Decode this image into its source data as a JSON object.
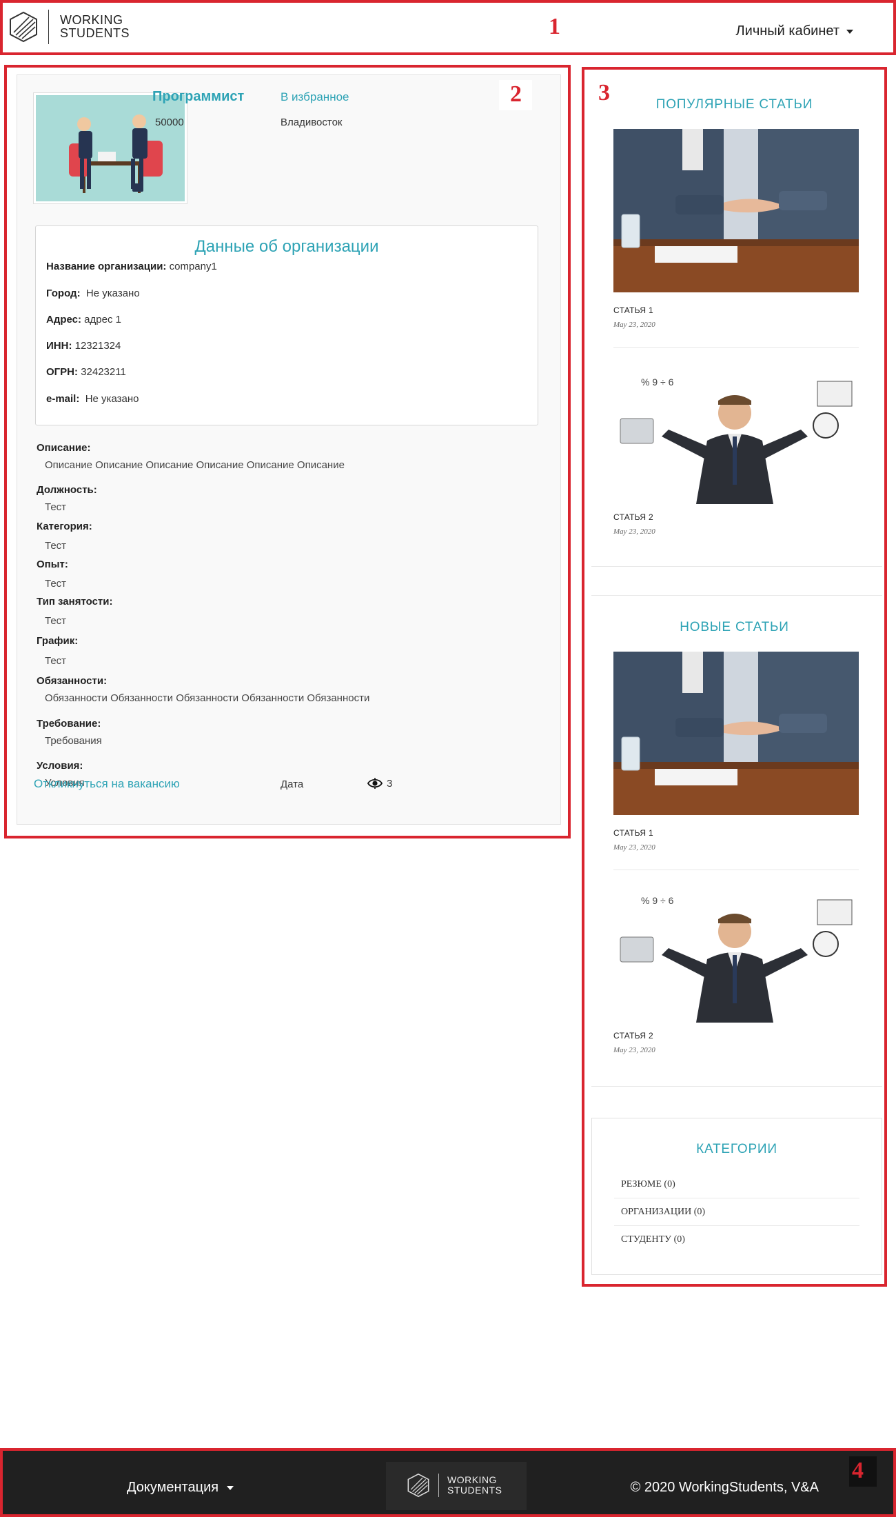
{
  "markers": [
    "1",
    "2",
    "3",
    "4"
  ],
  "header": {
    "logo_line1": "WORKING",
    "logo_line2": "STUDENTS",
    "account_label": "Личный кабинет"
  },
  "vacancy": {
    "title": "Программист",
    "favorite": "В избранное",
    "salary": "50000",
    "city": "Владивосток",
    "org_section_title": "Данные об организации",
    "org": [
      {
        "label": "Название организации:",
        "value": "company1"
      },
      {
        "label": "Город:",
        "value": "Не указано"
      },
      {
        "label": "Адрес:",
        "value": "адрес 1"
      },
      {
        "label": "ИНН:",
        "value": "12321324"
      },
      {
        "label": "ОГРН:",
        "value": "32423211"
      },
      {
        "label": "e-mail:",
        "value": "Не указано"
      }
    ],
    "fields": [
      {
        "label": "Описание:",
        "value": "Описание Описание Описание Описание Описание Описание"
      },
      {
        "label": "Должность:",
        "value": "Тест"
      },
      {
        "label": "Категория:",
        "value": "Тест"
      },
      {
        "label": "Опыт:",
        "value": "Тест"
      },
      {
        "label": "Тип занятости:",
        "value": "Тест"
      },
      {
        "label": "График:",
        "value": "Тест"
      },
      {
        "label": "Обязанности:",
        "value": "Обязанности Обязанности Обязанности Обязанности Обязанности"
      },
      {
        "label": "Требование:",
        "value": "Требования"
      },
      {
        "label": "Условия:",
        "value": "Условия"
      }
    ],
    "apply_link": "Откликнуться на вакансию",
    "date_label": "Дата",
    "views": "3"
  },
  "sidebar": {
    "popular_title": "ПОПУЛЯРНЫЕ СТАТЬИ",
    "popular": [
      {
        "title": "СТАТЬЯ 1",
        "date": "May 23, 2020",
        "image": "handshake-photo"
      },
      {
        "title": "СТАТЬЯ 2",
        "date": "May 23, 2020",
        "image": "multitasking-businessman-photo"
      }
    ],
    "new_title": "НОВЫЕ СТАТЬИ",
    "new": [
      {
        "title": "СТАТЬЯ 1",
        "date": "May 23, 2020",
        "image": "handshake-photo"
      },
      {
        "title": "СТАТЬЯ 2",
        "date": "May 23, 2020",
        "image": "multitasking-businessman-photo"
      }
    ],
    "categories_title": "КАТЕГОРИИ",
    "categories": [
      "РЕЗЮМЕ (0)",
      "ОРГАНИЗАЦИИ (0)",
      "СТУДЕНТУ (0)"
    ]
  },
  "footer": {
    "docs_label": "Документация",
    "logo_line1": "WORKING",
    "logo_line2": "STUDENTS",
    "copyright": "© 2020 WorkingStudents, V&A"
  },
  "colors": {
    "accent": "#2ea3b5",
    "annotation": "#d9252f",
    "footer_bg": "#202020"
  }
}
